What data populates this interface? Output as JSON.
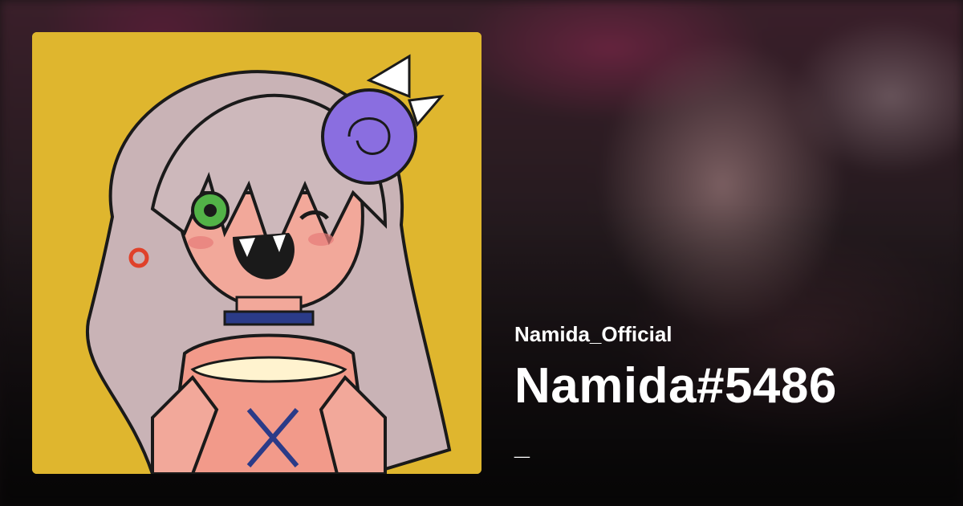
{
  "profile": {
    "avatar_icon": "anime-character-avatar-image",
    "username": "Namida_Official",
    "display_name": "Namida#5486",
    "bio": "_"
  },
  "colors": {
    "avatar_background": "#dfb62e",
    "text": "#ffffff",
    "background_dark": "#1b1417"
  }
}
